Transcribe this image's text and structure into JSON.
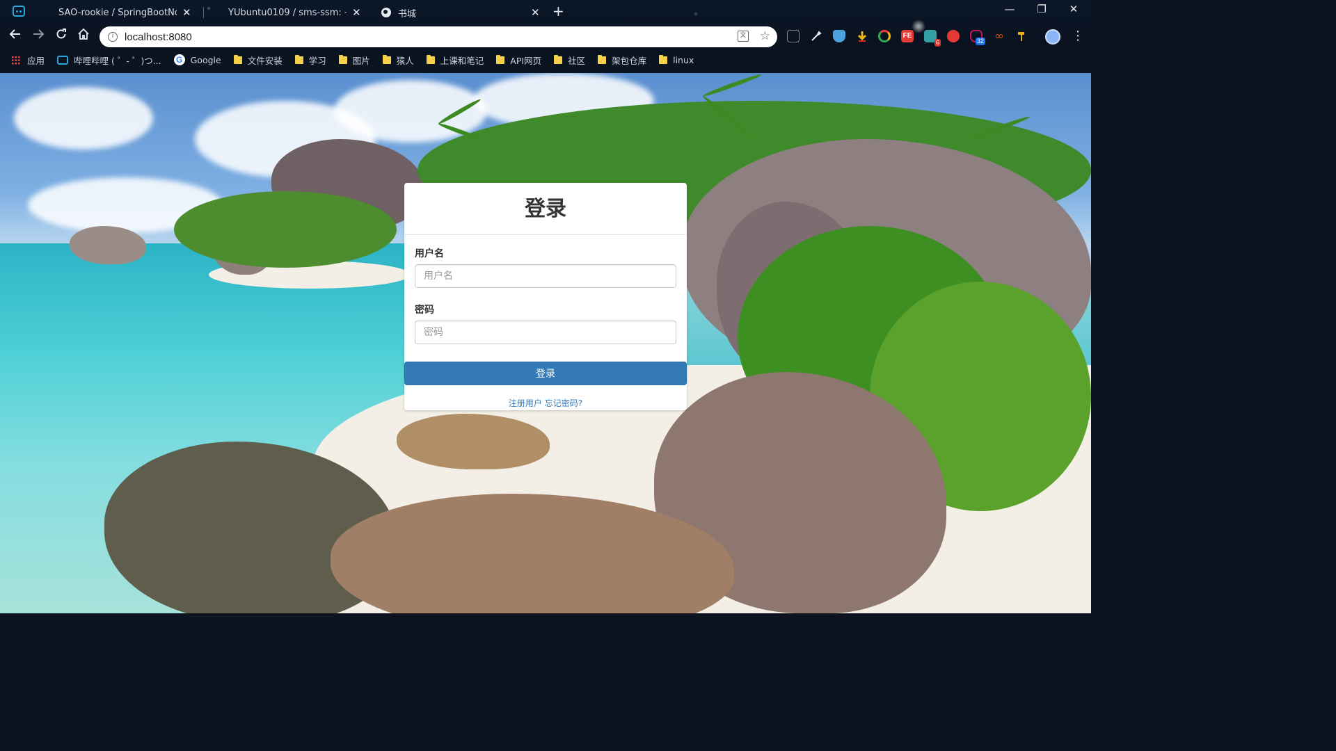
{
  "browser": {
    "tabs": [
      {
        "title": "SAO-rookie / SpringBootNovi",
        "active": false
      },
      {
        "title": "YUbuntu0109 / sms-ssm: —",
        "active": false
      },
      {
        "title": "书城",
        "active": true
      }
    ],
    "new_tab_symbol": "+",
    "window_controls": {
      "minimize": "—",
      "maximize": "❐",
      "close": "✕"
    },
    "url": "localhost:8080",
    "extensions": [
      {
        "icon": "glasses-icon",
        "color": "#2a2f38"
      },
      {
        "icon": "tool-icon",
        "color": "#e6ebf1"
      },
      {
        "icon": "shield-icon",
        "color": "#4aa3df"
      },
      {
        "icon": "download-arrow-icon",
        "color": "#e8b317"
      },
      {
        "icon": "ring-icon",
        "color": "#34a853"
      },
      {
        "icon": "fe-icon",
        "color": "#e53935"
      },
      {
        "icon": "puzzle-icon",
        "color": "#34a0a4",
        "badge": "6"
      },
      {
        "icon": "stop-icon",
        "color": "#e53935"
      },
      {
        "icon": "cat-icon",
        "color": "#c2185b",
        "badge": "32"
      },
      {
        "icon": "infinity-icon",
        "color": "#e8590c"
      },
      {
        "icon": "hammer-icon",
        "color": "#f2a900"
      }
    ],
    "bookmarks": [
      {
        "label": "应用",
        "icon": "apps-icon"
      },
      {
        "label": "哔哩哔哩 ( ゜- ゜)つ...",
        "icon": "bilibili-icon"
      },
      {
        "label": "Google",
        "icon": "google-icon"
      },
      {
        "label": "文件安装",
        "icon": "folder-icon"
      },
      {
        "label": "学习",
        "icon": "folder-icon"
      },
      {
        "label": "图片",
        "icon": "folder-icon"
      },
      {
        "label": "猿人",
        "icon": "folder-icon"
      },
      {
        "label": "上课和笔记",
        "icon": "folder-icon"
      },
      {
        "label": "API网页",
        "icon": "folder-icon"
      },
      {
        "label": "社区",
        "icon": "folder-icon"
      },
      {
        "label": "架包仓库",
        "icon": "folder-icon"
      },
      {
        "label": "linux",
        "icon": "folder-icon"
      }
    ]
  },
  "login": {
    "title": "登录",
    "username_label": "用户名",
    "username_placeholder": "用户名",
    "username_value": "",
    "password_label": "密码",
    "password_placeholder": "密码",
    "password_value": "",
    "submit_label": "登录",
    "register_link": "注册用户",
    "forgot_link": "忘记密码?"
  },
  "colors": {
    "primary": "#337ab7",
    "folder": "#f6d24a"
  }
}
